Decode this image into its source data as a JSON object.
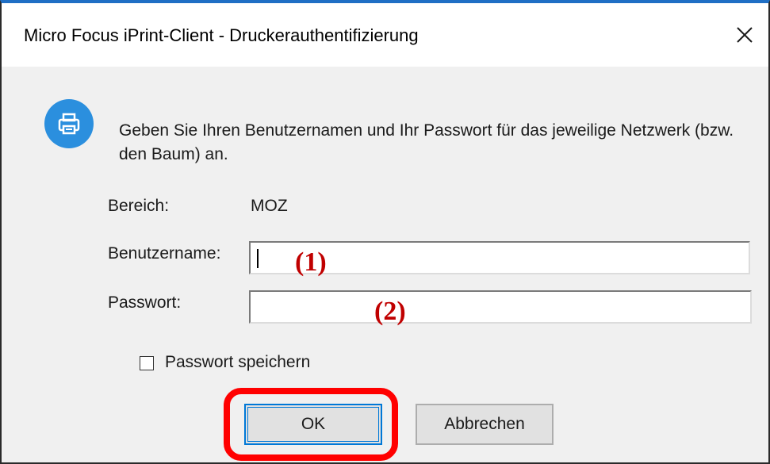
{
  "window": {
    "title": "Micro Focus iPrint-Client - Druckerauthentifizierung",
    "close_icon": "close-icon",
    "app_icon": "printer-icon",
    "accent": "#1f6fc5"
  },
  "dialog": {
    "message": "Geben Sie Ihren Benutzernamen und Ihr Passwort für das jeweilige Netzwerk (bzw. den Baum) an.",
    "realm_label": "Bereich:",
    "realm_value": "MOZ",
    "username_label": "Benutzername:",
    "username_value": "",
    "username_marker": "(1)",
    "password_label": "Passwort:",
    "password_value": "",
    "password_marker": "(2)",
    "save_password_label": "Passwort speichern",
    "save_password_checked": false
  },
  "buttons": {
    "ok_label": "OK",
    "cancel_label": "Abbrechen"
  },
  "annotation": {
    "highlight_color": "#ff0000",
    "marker_color": "#c00000"
  }
}
